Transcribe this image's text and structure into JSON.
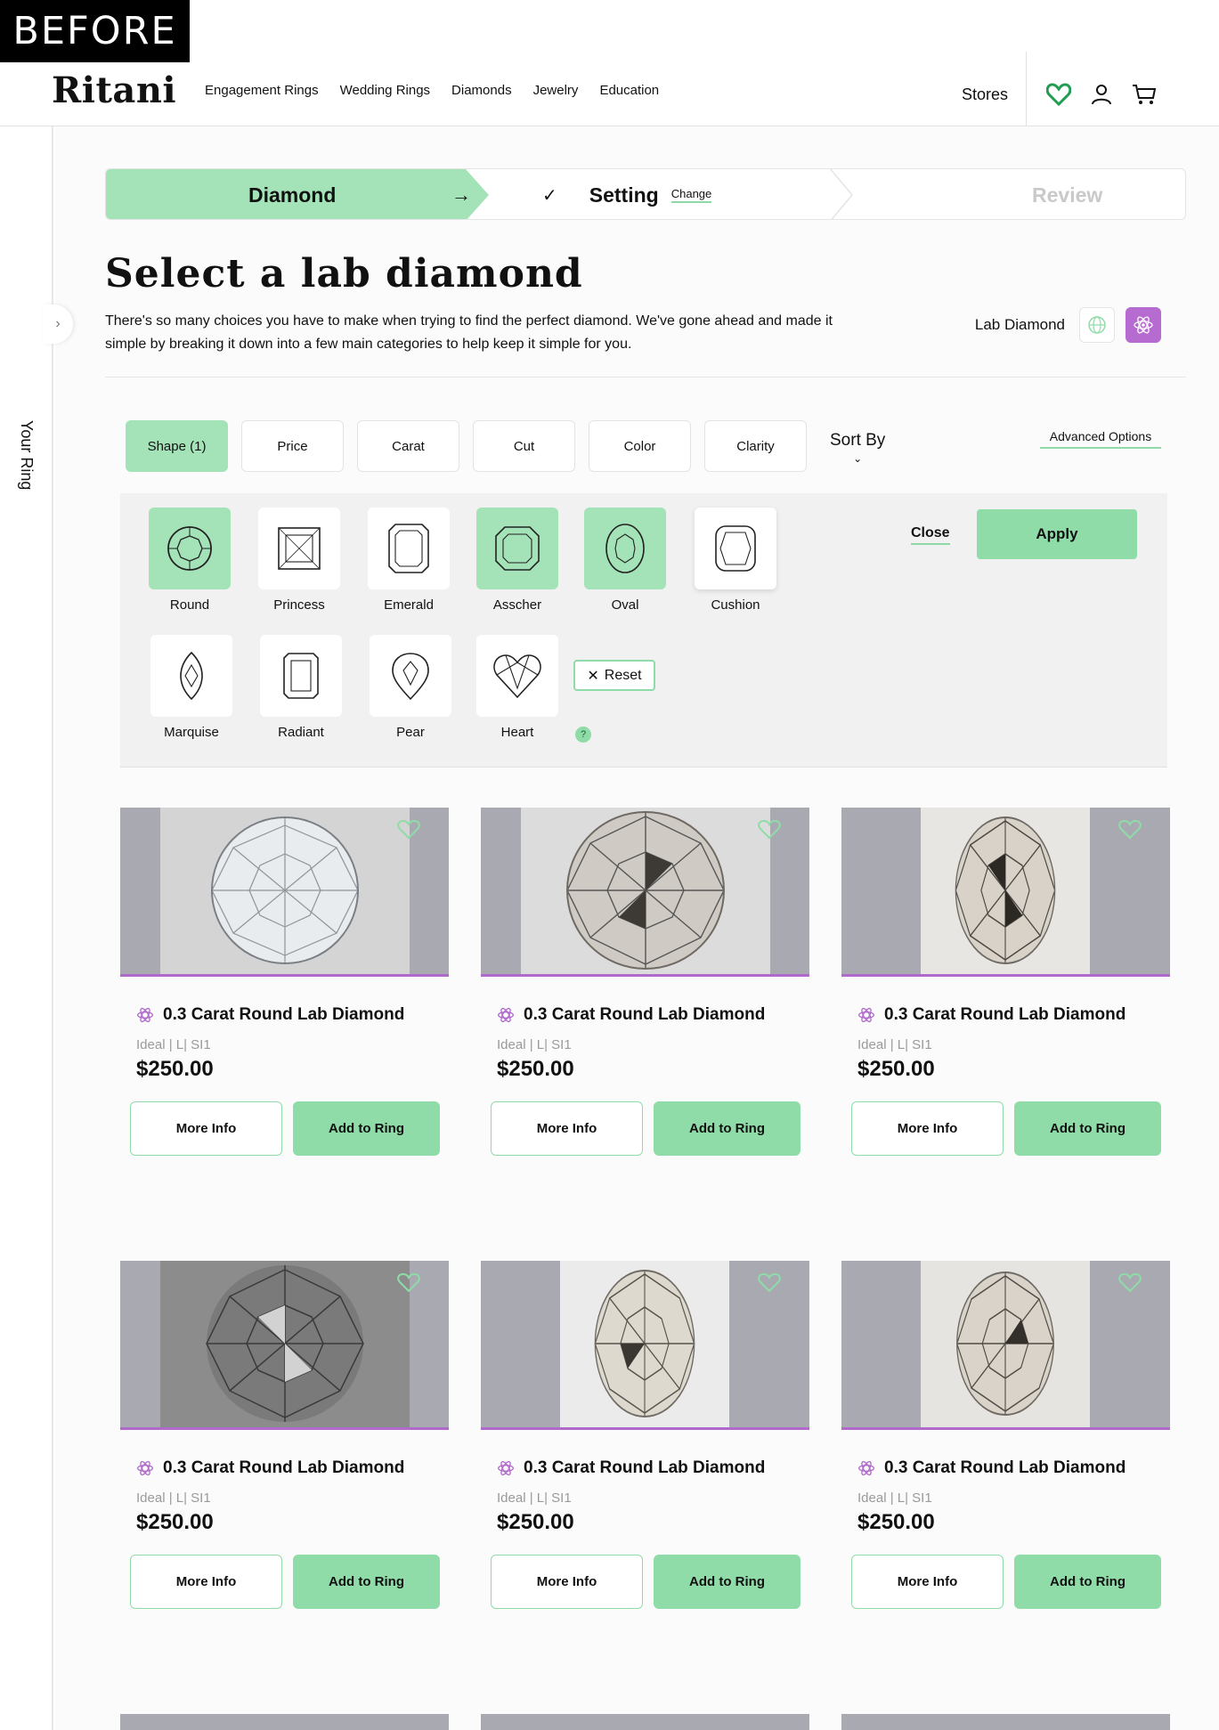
{
  "before_tag": "BEFORE",
  "header": {
    "logo": "Ritani",
    "nav": [
      "Engagement Rings",
      "Wedding Rings",
      "Diamonds",
      "Jewelry",
      "Education"
    ],
    "stores": "Stores",
    "icons": [
      "heart-icon",
      "user-icon",
      "cart-icon"
    ],
    "accent": "#1f9d52"
  },
  "sidebar": {
    "label": "Your Ring"
  },
  "stepper": {
    "step1": "Diamond",
    "step2": "Setting",
    "step2_action": "Change",
    "step3": "Review"
  },
  "page": {
    "title": "Select a lab diamond",
    "description": "There's so many choices you have to make when trying to find the perfect diamond. We've gone ahead and made it simple by breaking it down into a few main categories to help keep it simple for you.",
    "lab_toggle_label": "Lab Diamond"
  },
  "filters": {
    "tabs": [
      "Shape (1)",
      "Price",
      "Carat",
      "Cut",
      "Color",
      "Clarity"
    ],
    "sort_by": "Sort By",
    "advanced": "Advanced Options"
  },
  "shapes": {
    "items": [
      "Round",
      "Princess",
      "Emerald",
      "Asscher",
      "Oval",
      "Cushion",
      "Marquise",
      "Radiant",
      "Pear",
      "Heart"
    ],
    "selected": [
      "Round",
      "Asscher",
      "Oval"
    ],
    "close": "Close",
    "apply": "Apply",
    "reset": "Reset",
    "help": "?"
  },
  "products": [
    {
      "title": "0.3 Carat Round Lab Diamond",
      "spec": "Ideal | L| SI1",
      "price": "$250.00"
    },
    {
      "title": "0.3 Carat Round Lab Diamond",
      "spec": "Ideal | L| SI1",
      "price": "$250.00"
    },
    {
      "title": "0.3 Carat Round Lab Diamond",
      "spec": "Ideal | L| SI1",
      "price": "$250.00"
    },
    {
      "title": "0.3 Carat Round Lab Diamond",
      "spec": "Ideal | L| SI1",
      "price": "$250.00"
    },
    {
      "title": "0.3 Carat Round Lab Diamond",
      "spec": "Ideal | L| SI1",
      "price": "$250.00"
    },
    {
      "title": "0.3 Carat Round Lab Diamond",
      "spec": "Ideal | L| SI1",
      "price": "$250.00"
    }
  ],
  "card_actions": {
    "more": "More Info",
    "add": "Add to Ring"
  },
  "colors": {
    "mint": "#a4e3b8",
    "mint_strong": "#8fdca8",
    "purple": "#b06acb",
    "image_gray": "#a9a9b1"
  }
}
